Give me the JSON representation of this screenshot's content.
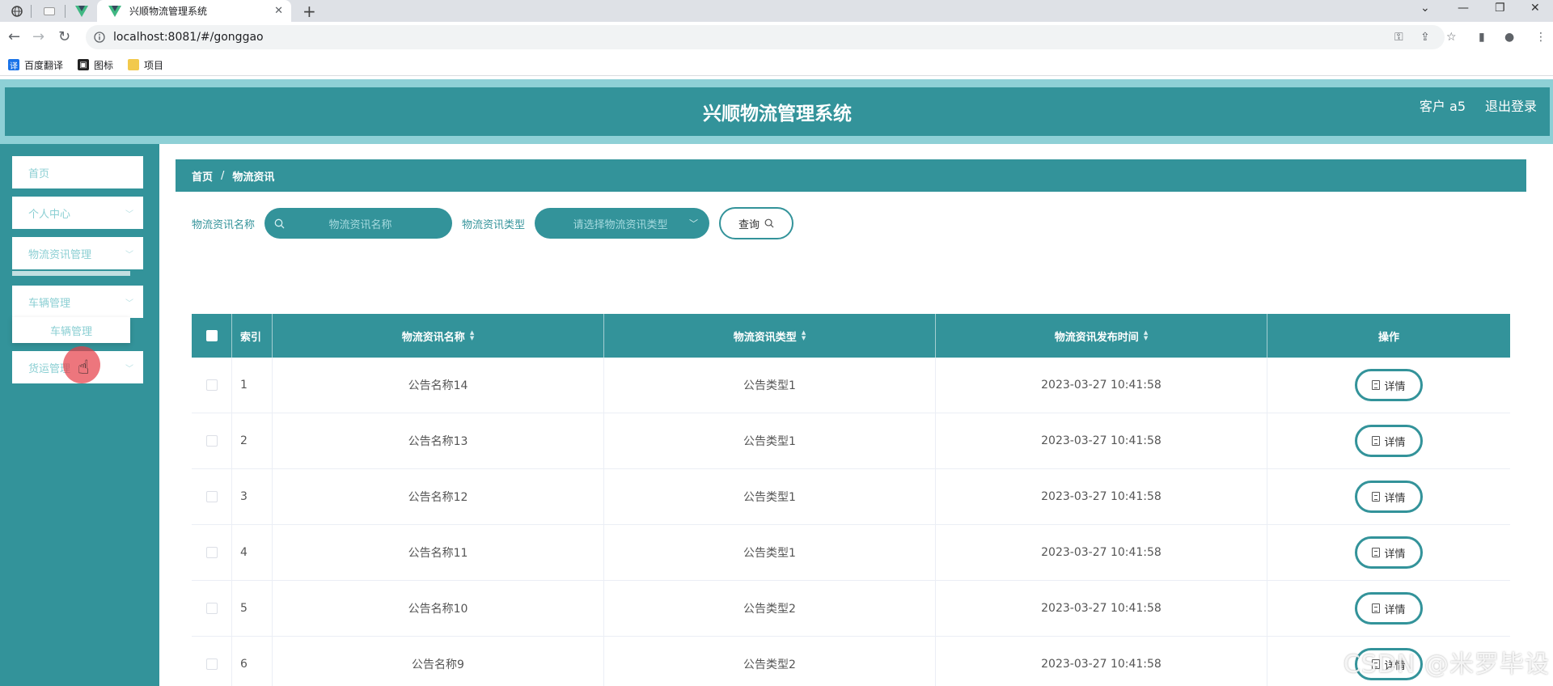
{
  "browser": {
    "tab_title": "兴顺物流管理系统",
    "tab_close": "✕",
    "new_tab": "+",
    "url": "localhost:8081/#/gonggao",
    "bookmarks": [
      {
        "label": "百度翻译",
        "icon": "translate-icon",
        "color": "#1a73e8"
      },
      {
        "label": "图标",
        "icon": "image-icon",
        "color": "#222222"
      },
      {
        "label": "项目",
        "icon": "folder-icon",
        "color": "#f2c94c"
      }
    ]
  },
  "app": {
    "title": "兴顺物流管理系统",
    "user_label": "客户 a5",
    "logout_label": "退出登录",
    "theme_color": "#33939a",
    "sidebar": {
      "items": [
        {
          "label": "首页"
        },
        {
          "label": "个人中心"
        },
        {
          "label": "物流资讯管理"
        },
        {
          "label": "车辆管理"
        },
        {
          "label": "货运管理"
        }
      ],
      "submenu_label": "车辆管理"
    },
    "breadcrumb": {
      "home": "首页",
      "separator": "/",
      "current": "物流资讯"
    },
    "filters": {
      "name_label": "物流资讯名称",
      "name_placeholder": "物流资讯名称",
      "type_label": "物流资讯类型",
      "type_placeholder": "请选择物流资讯类型",
      "search_label": "查询"
    },
    "table": {
      "headers": [
        "索引",
        "物流资讯名称",
        "物流资讯类型",
        "物流资讯发布时间",
        "操作"
      ],
      "detail_label": "详情",
      "rows": [
        {
          "index": "1",
          "name": "公告名称14",
          "type": "公告类型1",
          "time": "2023-03-27 10:41:58"
        },
        {
          "index": "2",
          "name": "公告名称13",
          "type": "公告类型1",
          "time": "2023-03-27 10:41:58"
        },
        {
          "index": "3",
          "name": "公告名称12",
          "type": "公告类型1",
          "time": "2023-03-27 10:41:58"
        },
        {
          "index": "4",
          "name": "公告名称11",
          "type": "公告类型1",
          "time": "2023-03-27 10:41:58"
        },
        {
          "index": "5",
          "name": "公告名称10",
          "type": "公告类型2",
          "time": "2023-03-27 10:41:58"
        },
        {
          "index": "6",
          "name": "公告名称9",
          "type": "公告类型2",
          "time": "2023-03-27 10:41:58"
        }
      ]
    }
  },
  "watermark": "CSDN @米罗毕设"
}
